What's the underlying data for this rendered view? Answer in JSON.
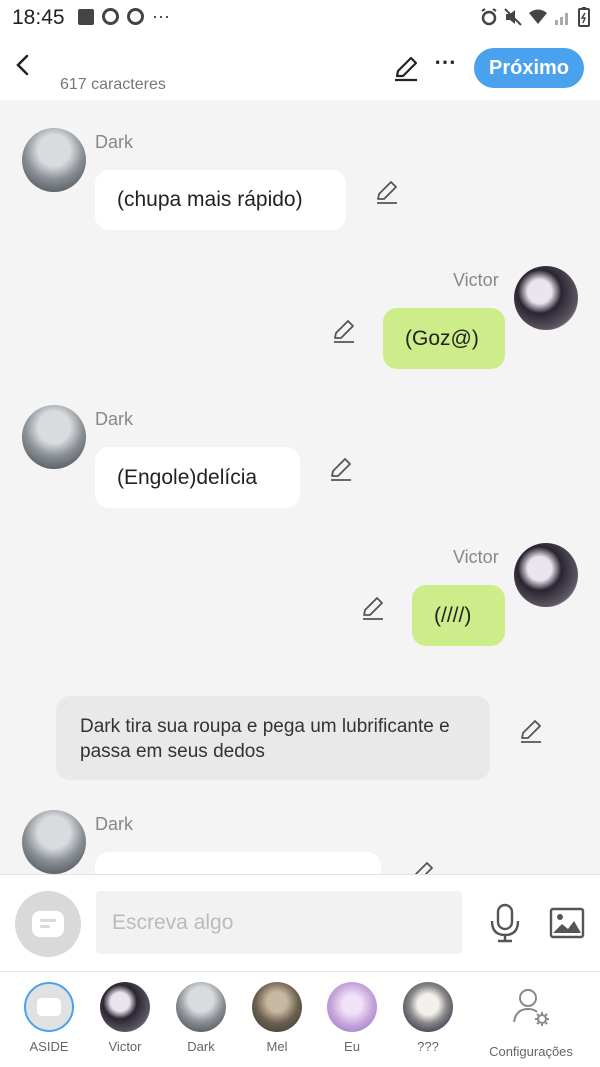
{
  "status_bar": {
    "time": "18:45",
    "more": "⋯"
  },
  "header": {
    "char_count": "617 caracteres",
    "next_label": "Próximo",
    "more": "⋯"
  },
  "messages": [
    {
      "sender": "Dark",
      "text": "(chupa mais rápido)",
      "side": "left"
    },
    {
      "sender": "Victor",
      "text": "(Goz@)",
      "side": "right"
    },
    {
      "sender": "Dark",
      "text": "(Engole)delícia",
      "side": "left"
    },
    {
      "sender": "Victor",
      "text": "(////)",
      "side": "right"
    },
    {
      "narration": "Dark tira sua roupa e pega um lubrificante e passa em seus dedos"
    },
    {
      "sender": "Dark",
      "text": "",
      "side": "left"
    }
  ],
  "input": {
    "placeholder": "Escreva algo",
    "value": ""
  },
  "tabs": [
    {
      "label": "ASIDE"
    },
    {
      "label": "Victor"
    },
    {
      "label": "Dark"
    },
    {
      "label": "Mel"
    },
    {
      "label": "Eu"
    },
    {
      "label": "???"
    },
    {
      "label": "Configurações"
    }
  ],
  "colors": {
    "accent": "#4aa1ee",
    "right_bubble": "#cdec8a",
    "left_bubble": "#ffffff",
    "narration_bg": "#e9e9e9",
    "background": "#f4f4f4"
  }
}
